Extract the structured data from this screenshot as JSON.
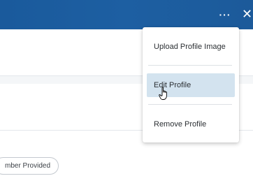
{
  "header": {
    "more_label": "···",
    "close_label": "✕",
    "more_icon": "ellipsis-icon",
    "close_icon": "close-icon",
    "background_color": "#1d5fa2"
  },
  "profile": {
    "pill_text": "mber Provided"
  },
  "menu": {
    "items": [
      {
        "label": "Upload Profile Image",
        "highlighted": false
      },
      {
        "label": "Edit Profile",
        "highlighted": true
      },
      {
        "label": "Remove Profile",
        "highlighted": false
      }
    ],
    "highlight_color": "#d3e3ef"
  },
  "cursor": {
    "icon": "hand-pointer-icon"
  }
}
